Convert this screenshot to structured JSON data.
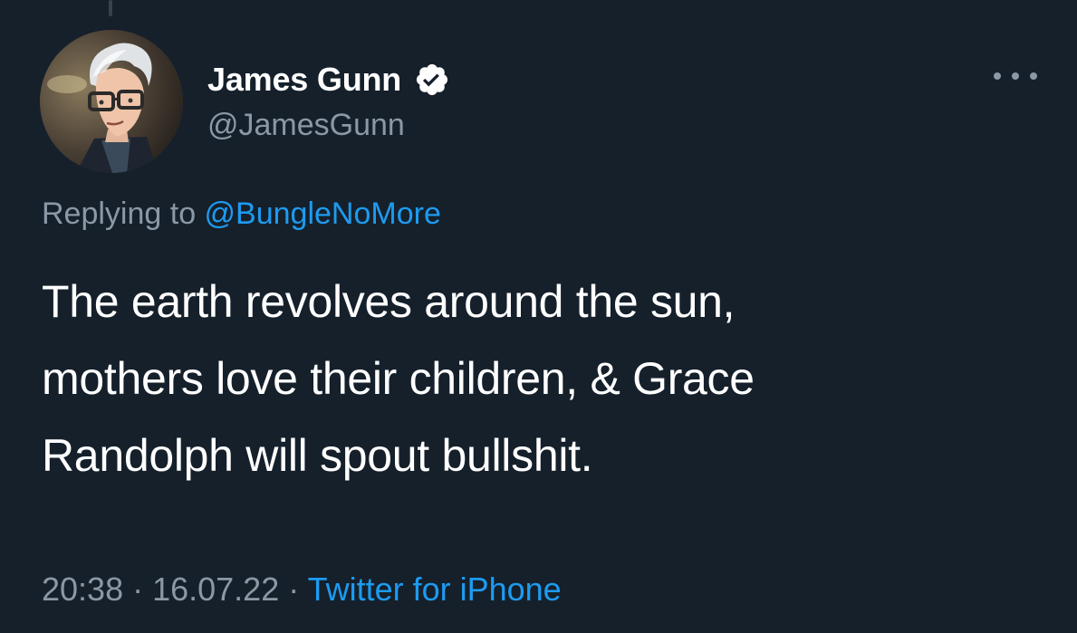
{
  "tweet": {
    "author": {
      "display_name": "James Gunn",
      "handle": "@JamesGunn",
      "verified": true
    },
    "reply_context": {
      "prefix": "Replying to ",
      "mention": "@BungleNoMore"
    },
    "text_lines": [
      "The earth revolves around the sun,",
      "mothers love their children, & Grace",
      "Randolph will spout bullshit."
    ],
    "meta": {
      "time": "20:38",
      "separator": " · ",
      "date": "16.07.22",
      "source": "Twitter for iPhone"
    }
  },
  "icons": {
    "verified": "verified-badge-icon",
    "more": "more-options-icon"
  },
  "colors": {
    "background": "#15202b",
    "text_primary": "#ffffff",
    "text_secondary": "#8b98a5",
    "accent": "#1d9bf0"
  }
}
